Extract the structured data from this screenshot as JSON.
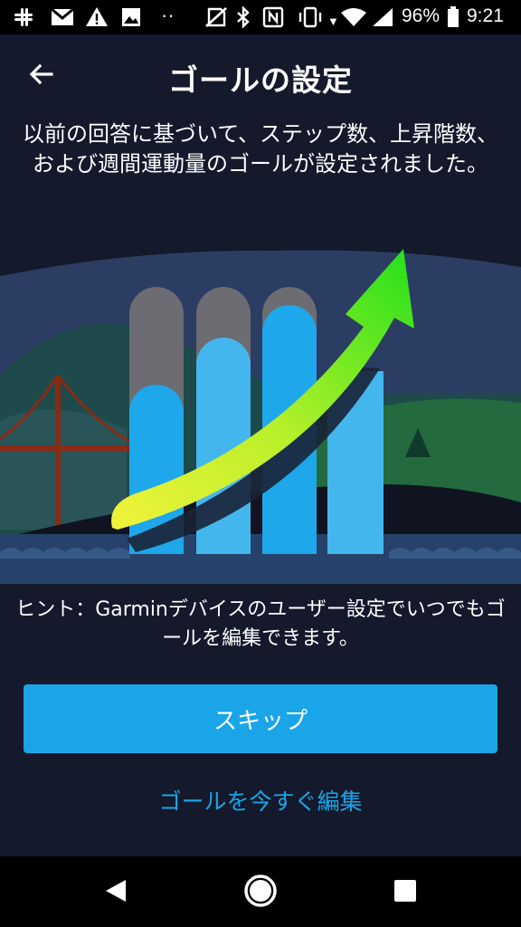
{
  "status_bar": {
    "icons": [
      "slack-icon",
      "gmail-icon",
      "warning-icon",
      "image-icon",
      "more-dots-icon",
      "no-sim-icon",
      "bluetooth-icon",
      "nfc-icon",
      "vibrate-icon",
      "wifi-icon",
      "signal-icon",
      "battery-icon"
    ],
    "battery": "96%",
    "time": "9:21"
  },
  "header": {
    "back_icon": "arrow-left-icon",
    "title": "ゴールの設定"
  },
  "main": {
    "description": "以前の回答に基づいて、ステップ数、上昇階数、および週間運動量のゴールが設定されました。",
    "illustration_icon": "goal-growth-illustration",
    "hint": "ヒント：Garminデバイスのユーザー設定でいつでもゴールを編集できます。",
    "skip_label": "スキップ",
    "edit_now_label": "ゴールを今すぐ編集"
  },
  "nav_bar": {
    "back_icon": "triangle-back-icon",
    "home_icon": "circle-home-icon",
    "recents_icon": "square-recents-icon"
  },
  "colors": {
    "background": "#14192b",
    "accent": "#1aa5e8",
    "arrow_green": "#22e01a",
    "arrow_yellow": "#f2f23a"
  }
}
